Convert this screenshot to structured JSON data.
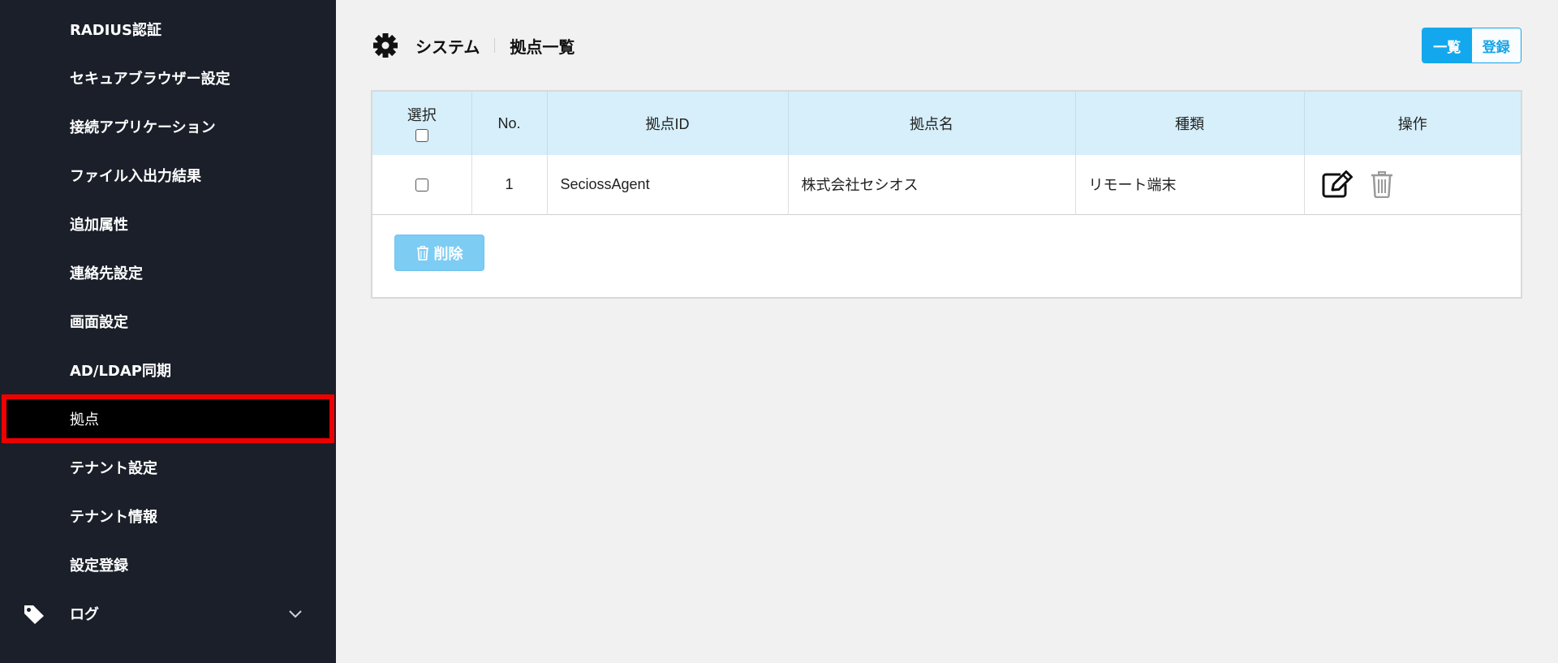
{
  "sidebar": {
    "items": [
      {
        "label": "RADIUS認証"
      },
      {
        "label": "セキュアブラウザー設定"
      },
      {
        "label": "接続アプリケーション"
      },
      {
        "label": "ファイル入出力結果"
      },
      {
        "label": "追加属性"
      },
      {
        "label": "連絡先設定"
      },
      {
        "label": "画面設定"
      },
      {
        "label": "AD/LDAP同期"
      },
      {
        "label": "拠点",
        "selected": true
      },
      {
        "label": "テナント設定"
      },
      {
        "label": "テナント情報"
      },
      {
        "label": "設定登録"
      },
      {
        "label": "ログ",
        "icon": "tag-icon",
        "expand_icon": "chevron-down-icon"
      }
    ],
    "highlight_color": "#ee0000"
  },
  "header": {
    "icon": "gear-icon",
    "section": "システム",
    "page": "拠点一覧"
  },
  "view_toggle": {
    "list_label": "一覧",
    "register_label": "登録",
    "active": "list"
  },
  "table": {
    "columns": [
      "選択",
      "No.",
      "拠点ID",
      "拠点名",
      "種類",
      "操作"
    ],
    "rows": [
      {
        "no": "1",
        "site_id": "SeciossAgent",
        "site_name": "株式会社セシオス",
        "type": "リモート端末",
        "actions": [
          "edit-icon",
          "trash-icon"
        ]
      }
    ]
  },
  "delete_button": {
    "label": "削除",
    "icon": "trash-icon"
  },
  "colors": {
    "accent": "#13a8ee",
    "sidebar_bg": "#1a1f29",
    "table_header_bg": "#d6effb"
  }
}
